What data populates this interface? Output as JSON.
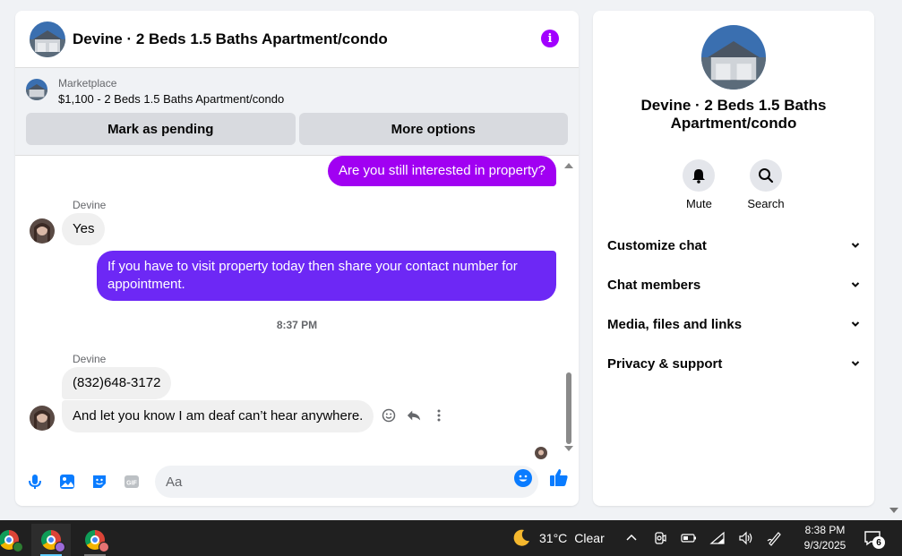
{
  "conversation": {
    "title": "Devine · 2 Beds 1.5 Baths Apartment/condo"
  },
  "marketplace": {
    "label": "Marketplace",
    "listing": "$1,100 - 2 Beds 1.5 Baths Apartment/condo",
    "mark_pending": "Mark as pending",
    "more_options": "More options"
  },
  "messages": {
    "out1": "Are you still interested in property?",
    "sender1": "Devine",
    "in1": "Yes",
    "out2": "If you have to visit property today then share your contact number for appointment.",
    "timestamp": "8:37 PM",
    "sender2": "Devine",
    "in2": "(832)648-3172",
    "in3": "And let you know I am deaf can’t hear anywhere."
  },
  "composer": {
    "placeholder": "Aa"
  },
  "info": {
    "title": "Devine · 2 Beds 1.5 Baths Apartment/condo",
    "mute": "Mute",
    "search": "Search",
    "menu": [
      {
        "label": "Customize chat"
      },
      {
        "label": "Chat members"
      },
      {
        "label": "Media, files and links"
      },
      {
        "label": "Privacy & support"
      }
    ]
  },
  "taskbar": {
    "temperature": "31°C",
    "weather": "Clear",
    "time": "8:38 PM",
    "date": "9/3/2025",
    "notifications": "6"
  },
  "colors": {
    "accent_purple": "#a100f2",
    "accent_violet": "#6d28f5",
    "accent_blue": "#0a7cff"
  }
}
